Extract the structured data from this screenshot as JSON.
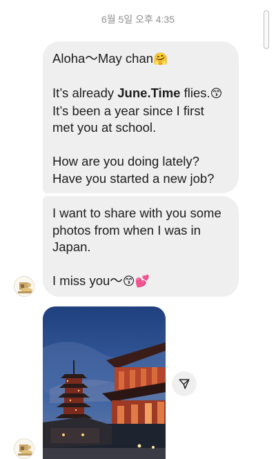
{
  "timestamp": "6월 5일 오후 4:35",
  "message1": {
    "greeting": "Aloha〜May chan",
    "greeting_emoji": "🤗",
    "line2_pre": "It’s already ",
    "line2_bold": "June.Time",
    "line2_post": " flies.",
    "line2_emoji": "😙",
    "line3": "It’s been a year since I first",
    "line4": "met you at school.",
    "line5": "How are you doing lately?",
    "line6": "Have you started a new job?"
  },
  "message2": {
    "line1": "I want to share with you some",
    "line2": "photos from when I was in",
    "line3": "Japan.",
    "line4": "I miss you〜",
    "line4_emoji": "😙💕"
  },
  "icons": {
    "share": "paper-plane-icon",
    "avatar": "contact-avatar",
    "photo": "japan-temple-photo"
  }
}
